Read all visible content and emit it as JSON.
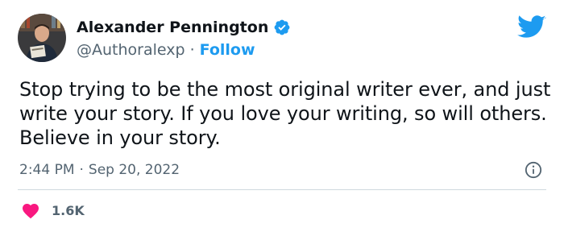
{
  "author": {
    "display_name": "Alexander Pennington",
    "handle": "@Authoralexp",
    "separator": "·",
    "follow_label": "Follow",
    "verified": true,
    "avatar_icon": "author-photo"
  },
  "tweet": {
    "text": "Stop trying to be the most original writer ever, and just write your story. If you love your writing, so will others. Believe in your story."
  },
  "meta": {
    "time": "2:44 PM",
    "separator": "·",
    "date": "Sep 20, 2022"
  },
  "engagement": {
    "likes": "1.6K"
  },
  "colors": {
    "twitter_blue": "#1d9bf0",
    "heart_pink": "#f91880",
    "secondary_text": "#536471"
  },
  "icons": {
    "brand": "twitter-bird-icon",
    "verified": "verified-badge-icon",
    "info": "info-icon",
    "like": "heart-icon"
  }
}
